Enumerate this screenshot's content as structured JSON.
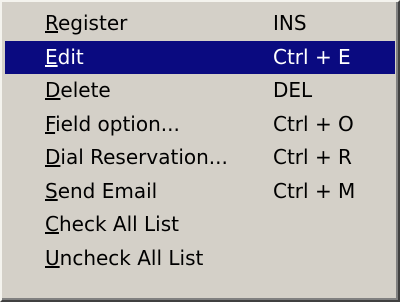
{
  "menu": {
    "items": [
      {
        "label": "Register",
        "mnemonic": "R",
        "rest": "egister",
        "shortcut": "INS",
        "selected": false
      },
      {
        "label": "Edit",
        "mnemonic": "E",
        "rest": "dit",
        "shortcut": "Ctrl + E",
        "selected": true
      },
      {
        "label": "Delete",
        "mnemonic": "D",
        "rest": "elete",
        "shortcut": "DEL",
        "selected": false
      },
      {
        "label": "Field option...",
        "mnemonic": "F",
        "rest": "ield option...",
        "shortcut": "Ctrl + O",
        "selected": false
      },
      {
        "label": "Dial Reservation...",
        "mnemonic": "D",
        "rest": "ial Reservation...",
        "shortcut": "Ctrl + R",
        "selected": false
      },
      {
        "label": "Send Email",
        "mnemonic": "S",
        "rest": "end Email",
        "shortcut": "Ctrl + M",
        "selected": false
      },
      {
        "label": "Check All List",
        "mnemonic": "C",
        "rest": "heck All List",
        "shortcut": "",
        "selected": false
      },
      {
        "label": "Uncheck All List",
        "mnemonic": "U",
        "rest": "ncheck All List",
        "shortcut": "",
        "selected": false
      }
    ],
    "colors": {
      "background": "#d4d0c8",
      "highlight": "#0a0a80",
      "highlight_text": "#ffffff",
      "text": "#000000"
    }
  }
}
